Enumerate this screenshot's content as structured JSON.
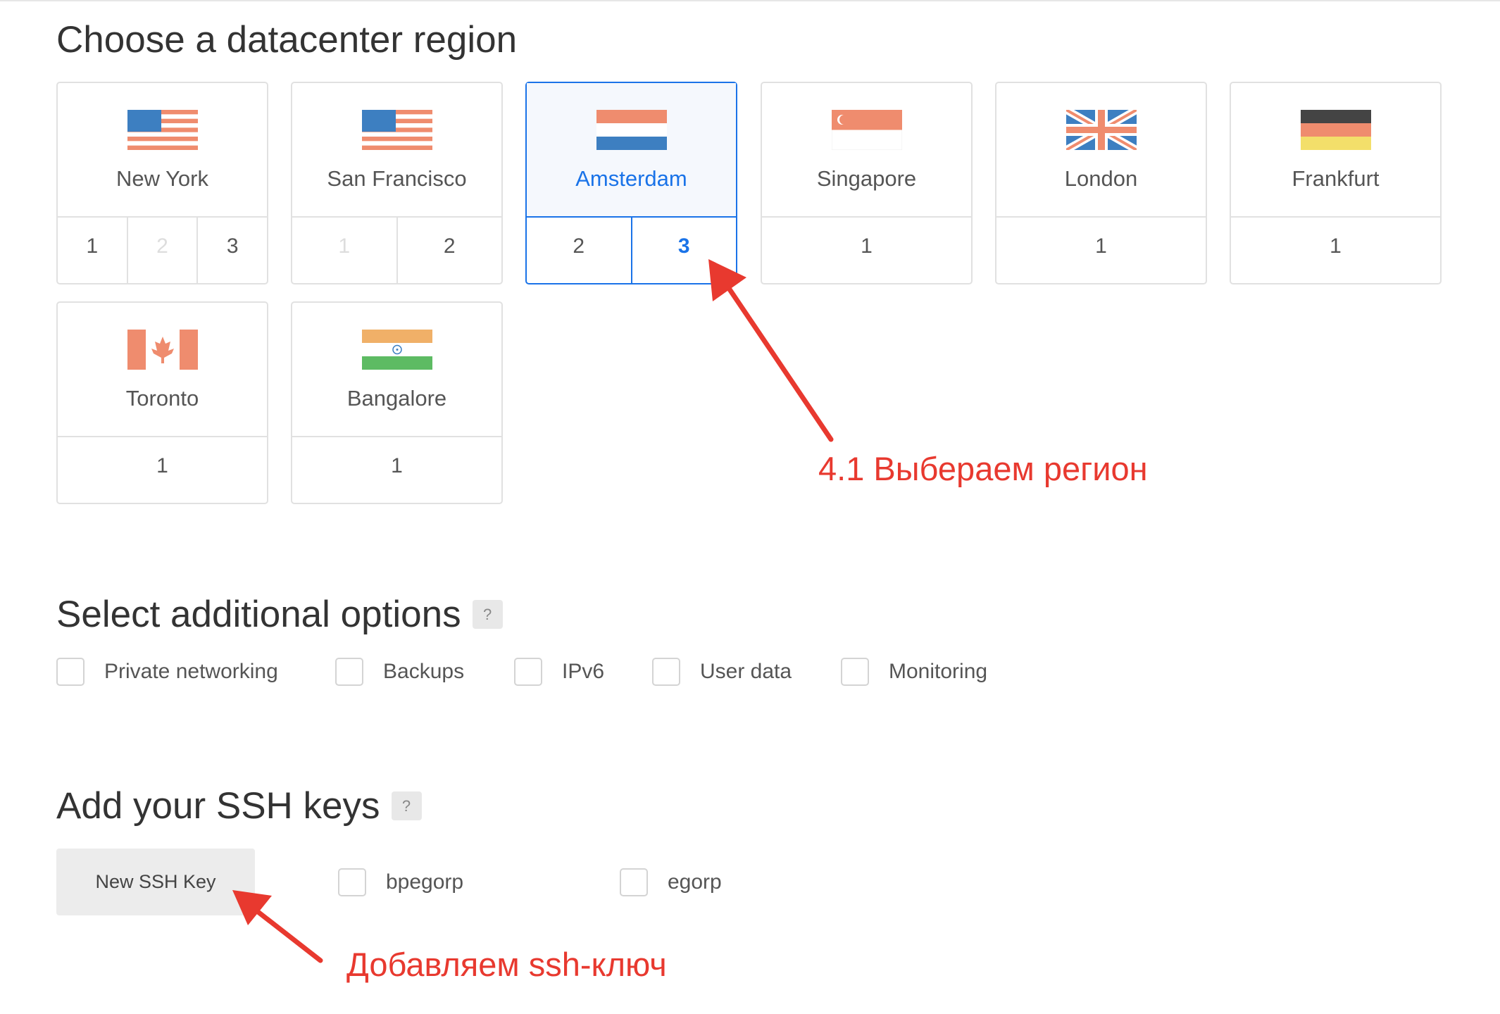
{
  "region_section": {
    "title": "Choose a datacenter region",
    "regions": [
      {
        "name": "New York",
        "flag": "us-flag-icon",
        "datacenters": [
          {
            "label": "1",
            "state": "normal"
          },
          {
            "label": "2",
            "state": "disabled"
          },
          {
            "label": "3",
            "state": "normal"
          }
        ]
      },
      {
        "name": "San Francisco",
        "flag": "us-flag-icon",
        "datacenters": [
          {
            "label": "1",
            "state": "disabled"
          },
          {
            "label": "2",
            "state": "normal"
          }
        ]
      },
      {
        "name": "Amsterdam",
        "flag": "netherlands-flag-icon",
        "selected": true,
        "datacenters": [
          {
            "label": "2",
            "state": "normal"
          },
          {
            "label": "3",
            "state": "active"
          }
        ]
      },
      {
        "name": "Singapore",
        "flag": "singapore-flag-icon",
        "datacenters": [
          {
            "label": "1",
            "state": "normal"
          }
        ]
      },
      {
        "name": "London",
        "flag": "uk-flag-icon",
        "datacenters": [
          {
            "label": "1",
            "state": "normal"
          }
        ]
      },
      {
        "name": "Frankfurt",
        "flag": "germany-flag-icon",
        "datacenters": [
          {
            "label": "1",
            "state": "normal"
          }
        ]
      },
      {
        "name": "Toronto",
        "flag": "canada-flag-icon",
        "datacenters": [
          {
            "label": "1",
            "state": "normal"
          }
        ]
      },
      {
        "name": "Bangalore",
        "flag": "india-flag-icon",
        "datacenters": [
          {
            "label": "1",
            "state": "normal"
          }
        ]
      }
    ]
  },
  "options_section": {
    "title": "Select additional options",
    "help": "?",
    "options": [
      {
        "label": "Private networking",
        "checked": false
      },
      {
        "label": "Backups",
        "checked": false
      },
      {
        "label": "IPv6",
        "checked": false
      },
      {
        "label": "User data",
        "checked": false
      },
      {
        "label": "Monitoring",
        "checked": false
      }
    ]
  },
  "ssh_section": {
    "title": "Add your SSH keys",
    "help": "?",
    "new_key_button": "New SSH Key",
    "keys": [
      {
        "label": "bpegorp",
        "checked": false
      },
      {
        "label": "egorp",
        "checked": false
      }
    ]
  },
  "annotations": {
    "region_note": "4.1 Выбераем регион",
    "ssh_note": "Добавляем ssh-ключ",
    "color": "#e8392f"
  }
}
